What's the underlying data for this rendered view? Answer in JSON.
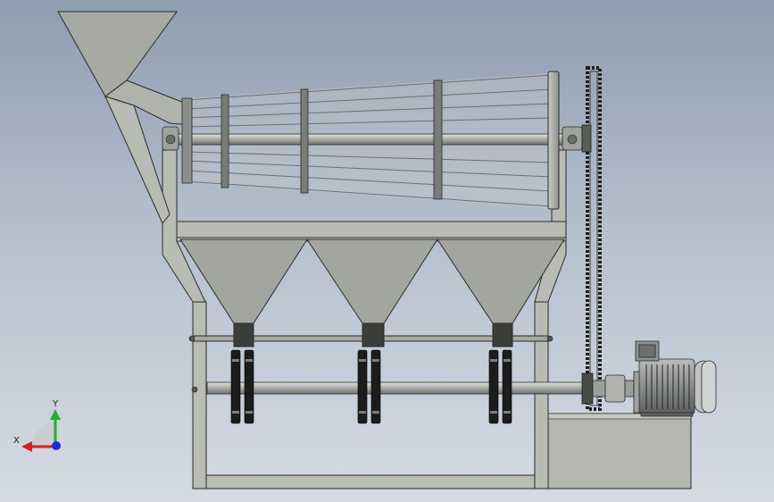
{
  "triad": {
    "x_label": "X",
    "y_label": "Y"
  },
  "colors": {
    "steel": "#a9aba6",
    "steel_dark": "#6e706b",
    "frame": "#b9bbb5",
    "outline": "#2a2a2a",
    "chain": "#1e1e1e",
    "motor": "#8a8d8c",
    "axis_x": "#d81e1e",
    "axis_y": "#1fb02a",
    "axis_z": "#1e2bd8"
  }
}
